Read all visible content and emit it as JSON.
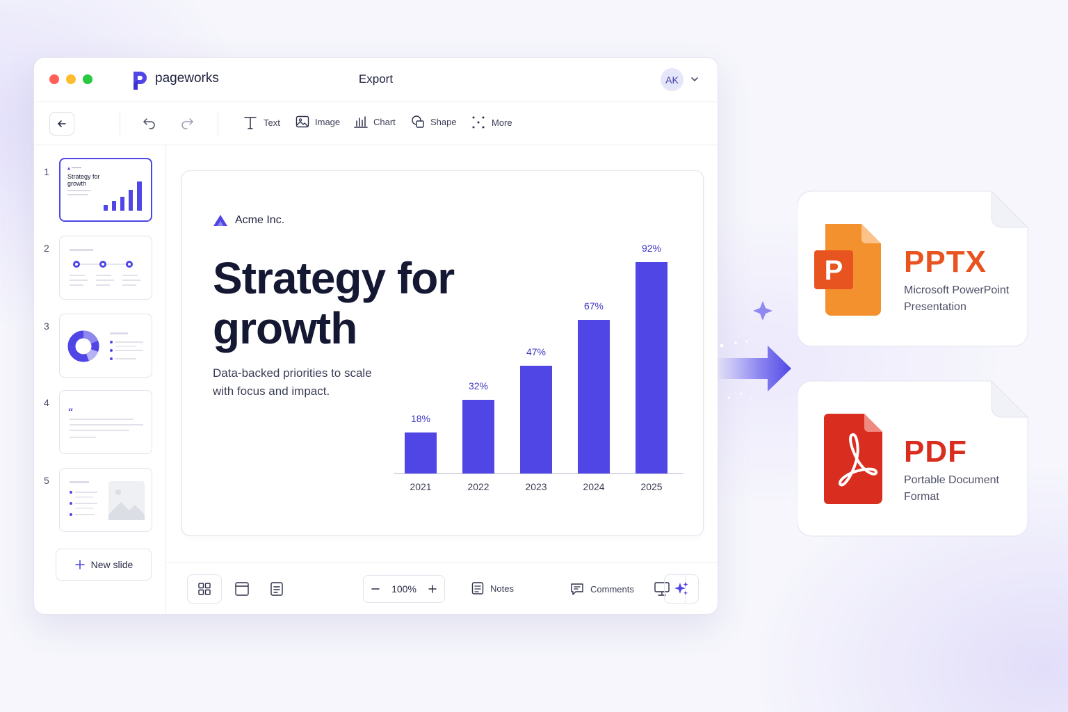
{
  "app": {
    "brand": "pageworks",
    "window_title": "Export",
    "user_initials": "AK"
  },
  "toolbar": {
    "tools": [
      {
        "label": "Text",
        "icon": "text-icon"
      },
      {
        "label": "Image",
        "icon": "image-icon"
      },
      {
        "label": "Chart",
        "icon": "chart-icon"
      },
      {
        "label": "Shape",
        "icon": "shape-icon"
      },
      {
        "label": "More",
        "icon": "more-icon"
      }
    ]
  },
  "sidebar": {
    "slides": [
      {
        "number": "1",
        "active": true,
        "title": "Strategy for growth"
      },
      {
        "number": "2",
        "active": false
      },
      {
        "number": "3",
        "active": false
      },
      {
        "number": "4",
        "active": false
      },
      {
        "number": "5",
        "active": false
      }
    ],
    "new_slide_label": "New slide"
  },
  "slide": {
    "company": "Acme Inc.",
    "headline_line1": "Strategy for",
    "headline_line2": "growth",
    "subtitle_line1": "Data-backed priorities to scale",
    "subtitle_line2": "with focus and impact."
  },
  "chart_data": {
    "type": "bar",
    "categories": [
      "2021",
      "2022",
      "2023",
      "2024",
      "2025"
    ],
    "values": [
      18,
      32,
      47,
      67,
      92
    ],
    "data_labels": [
      "18%",
      "32%",
      "47%",
      "67%",
      "92%"
    ],
    "ylim": [
      0,
      100
    ],
    "grid": false,
    "color": "#4f46e5"
  },
  "bottombar": {
    "zoom": "100%",
    "notes_label": "Notes",
    "comments_label": "Comments"
  },
  "exports": [
    {
      "format": "PPTX",
      "desc_line1": "Microsoft PowerPoint",
      "desc_line2": "Presentation",
      "color": "#e8541f"
    },
    {
      "format": "PDF",
      "desc_line1": "Portable Document",
      "desc_line2": "Format",
      "color": "#d92d20"
    }
  ],
  "colors": {
    "accent": "#4f46e5",
    "pptx": "#e8541f",
    "pdf": "#d92d20"
  }
}
